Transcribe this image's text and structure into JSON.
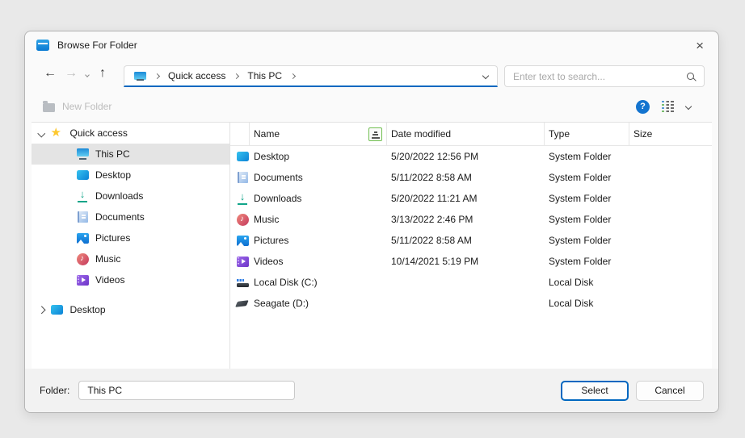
{
  "window": {
    "title": "Browse For Folder",
    "close_glyph": "×"
  },
  "nav": {
    "back_glyph": "←",
    "forward_glyph": "→",
    "up_glyph": "↑",
    "breadcrumb": {
      "items": [
        "Quick access",
        "This PC"
      ]
    },
    "search": {
      "placeholder": "Enter text to search..."
    }
  },
  "toolbar": {
    "new_folder_label": "New Folder"
  },
  "tree": {
    "items": [
      {
        "label": "Quick access",
        "icon": "star-icon",
        "classes": "level-0",
        "expander": "down"
      },
      {
        "label": "This PC",
        "icon": "monitor-icon",
        "classes": "level-1 selected",
        "expander": "none"
      },
      {
        "label": "Desktop",
        "icon": "desktop-icon",
        "classes": "level-1",
        "expander": "none"
      },
      {
        "label": "Downloads",
        "icon": "downloads-icon",
        "classes": "level-1",
        "expander": "none"
      },
      {
        "label": "Documents",
        "icon": "documents-icon",
        "classes": "level-1",
        "expander": "none"
      },
      {
        "label": "Pictures",
        "icon": "pictures-icon",
        "classes": "level-1",
        "expander": "none"
      },
      {
        "label": "Music",
        "icon": "music-icon",
        "classes": "level-1",
        "expander": "none"
      },
      {
        "label": "Videos",
        "icon": "videos-icon",
        "classes": "level-1",
        "expander": "none"
      },
      {
        "label": "Desktop",
        "icon": "desktop-icon",
        "classes": "level-0 root-gap",
        "expander": "right"
      }
    ]
  },
  "list": {
    "columns": {
      "name": "Name",
      "date_modified": "Date modified",
      "type": "Type",
      "size": "Size"
    },
    "rows": [
      {
        "name": "Desktop",
        "icon": "desktop-icon",
        "date_modified": "5/20/2022 12:56 PM",
        "type": "System Folder",
        "size": ""
      },
      {
        "name": "Documents",
        "icon": "documents-icon",
        "date_modified": "5/11/2022 8:58 AM",
        "type": "System Folder",
        "size": ""
      },
      {
        "name": "Downloads",
        "icon": "downloads-icon",
        "date_modified": "5/20/2022 11:21 AM",
        "type": "System Folder",
        "size": ""
      },
      {
        "name": "Music",
        "icon": "music-icon",
        "date_modified": "3/13/2022 2:46 PM",
        "type": "System Folder",
        "size": ""
      },
      {
        "name": "Pictures",
        "icon": "pictures-icon",
        "date_modified": "5/11/2022 8:58 AM",
        "type": "System Folder",
        "size": ""
      },
      {
        "name": "Videos",
        "icon": "videos-icon",
        "date_modified": "10/14/2021 5:19 PM",
        "type": "System Folder",
        "size": ""
      },
      {
        "name": "Local Disk (C:)",
        "icon": "drive-icon",
        "date_modified": "",
        "type": "Local Disk",
        "size": ""
      },
      {
        "name": "Seagate (D:)",
        "icon": "external-drive-icon",
        "date_modified": "",
        "type": "Local Disk",
        "size": ""
      }
    ]
  },
  "footer": {
    "folder_label": "Folder:",
    "folder_value": "This PC",
    "select_label": "Select",
    "cancel_label": "Cancel"
  }
}
